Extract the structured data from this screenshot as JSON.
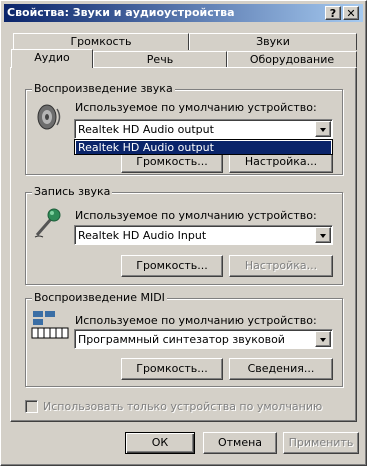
{
  "window": {
    "title": "Свойства: Звуки и аудиоустройства",
    "help_glyph": "?",
    "close_glyph": "✕"
  },
  "tabs_back": [
    "Громкость",
    "Звуки"
  ],
  "tabs_front": [
    "Аудио",
    "Речь",
    "Оборудование"
  ],
  "playback": {
    "group_label": "Воспроизведение звука",
    "device_label": "Используемое по умолчанию устройство:",
    "selected": "Realtek HD Audio output",
    "dropdown_options": [
      "Realtek HD Audio output"
    ],
    "volume_button": "Громкость...",
    "settings_button": "Настройка..."
  },
  "recording": {
    "group_label": "Запись звука",
    "device_label": "Используемое по умолчанию устройство:",
    "selected": "Realtek HD Audio Input",
    "volume_button": "Громкость...",
    "settings_button": "Настройка..."
  },
  "midi": {
    "group_label": "Воспроизведение MIDI",
    "device_label": "Используемое по умолчанию устройство:",
    "selected": "Программный синтезатор звуковой",
    "volume_button": "Громкость...",
    "about_button": "Сведения..."
  },
  "default_only_checkbox": {
    "label": "Использовать только устройства по умолчанию",
    "checked": false
  },
  "footer": {
    "ok": "ОК",
    "cancel": "Отмена",
    "apply": "Применить"
  }
}
